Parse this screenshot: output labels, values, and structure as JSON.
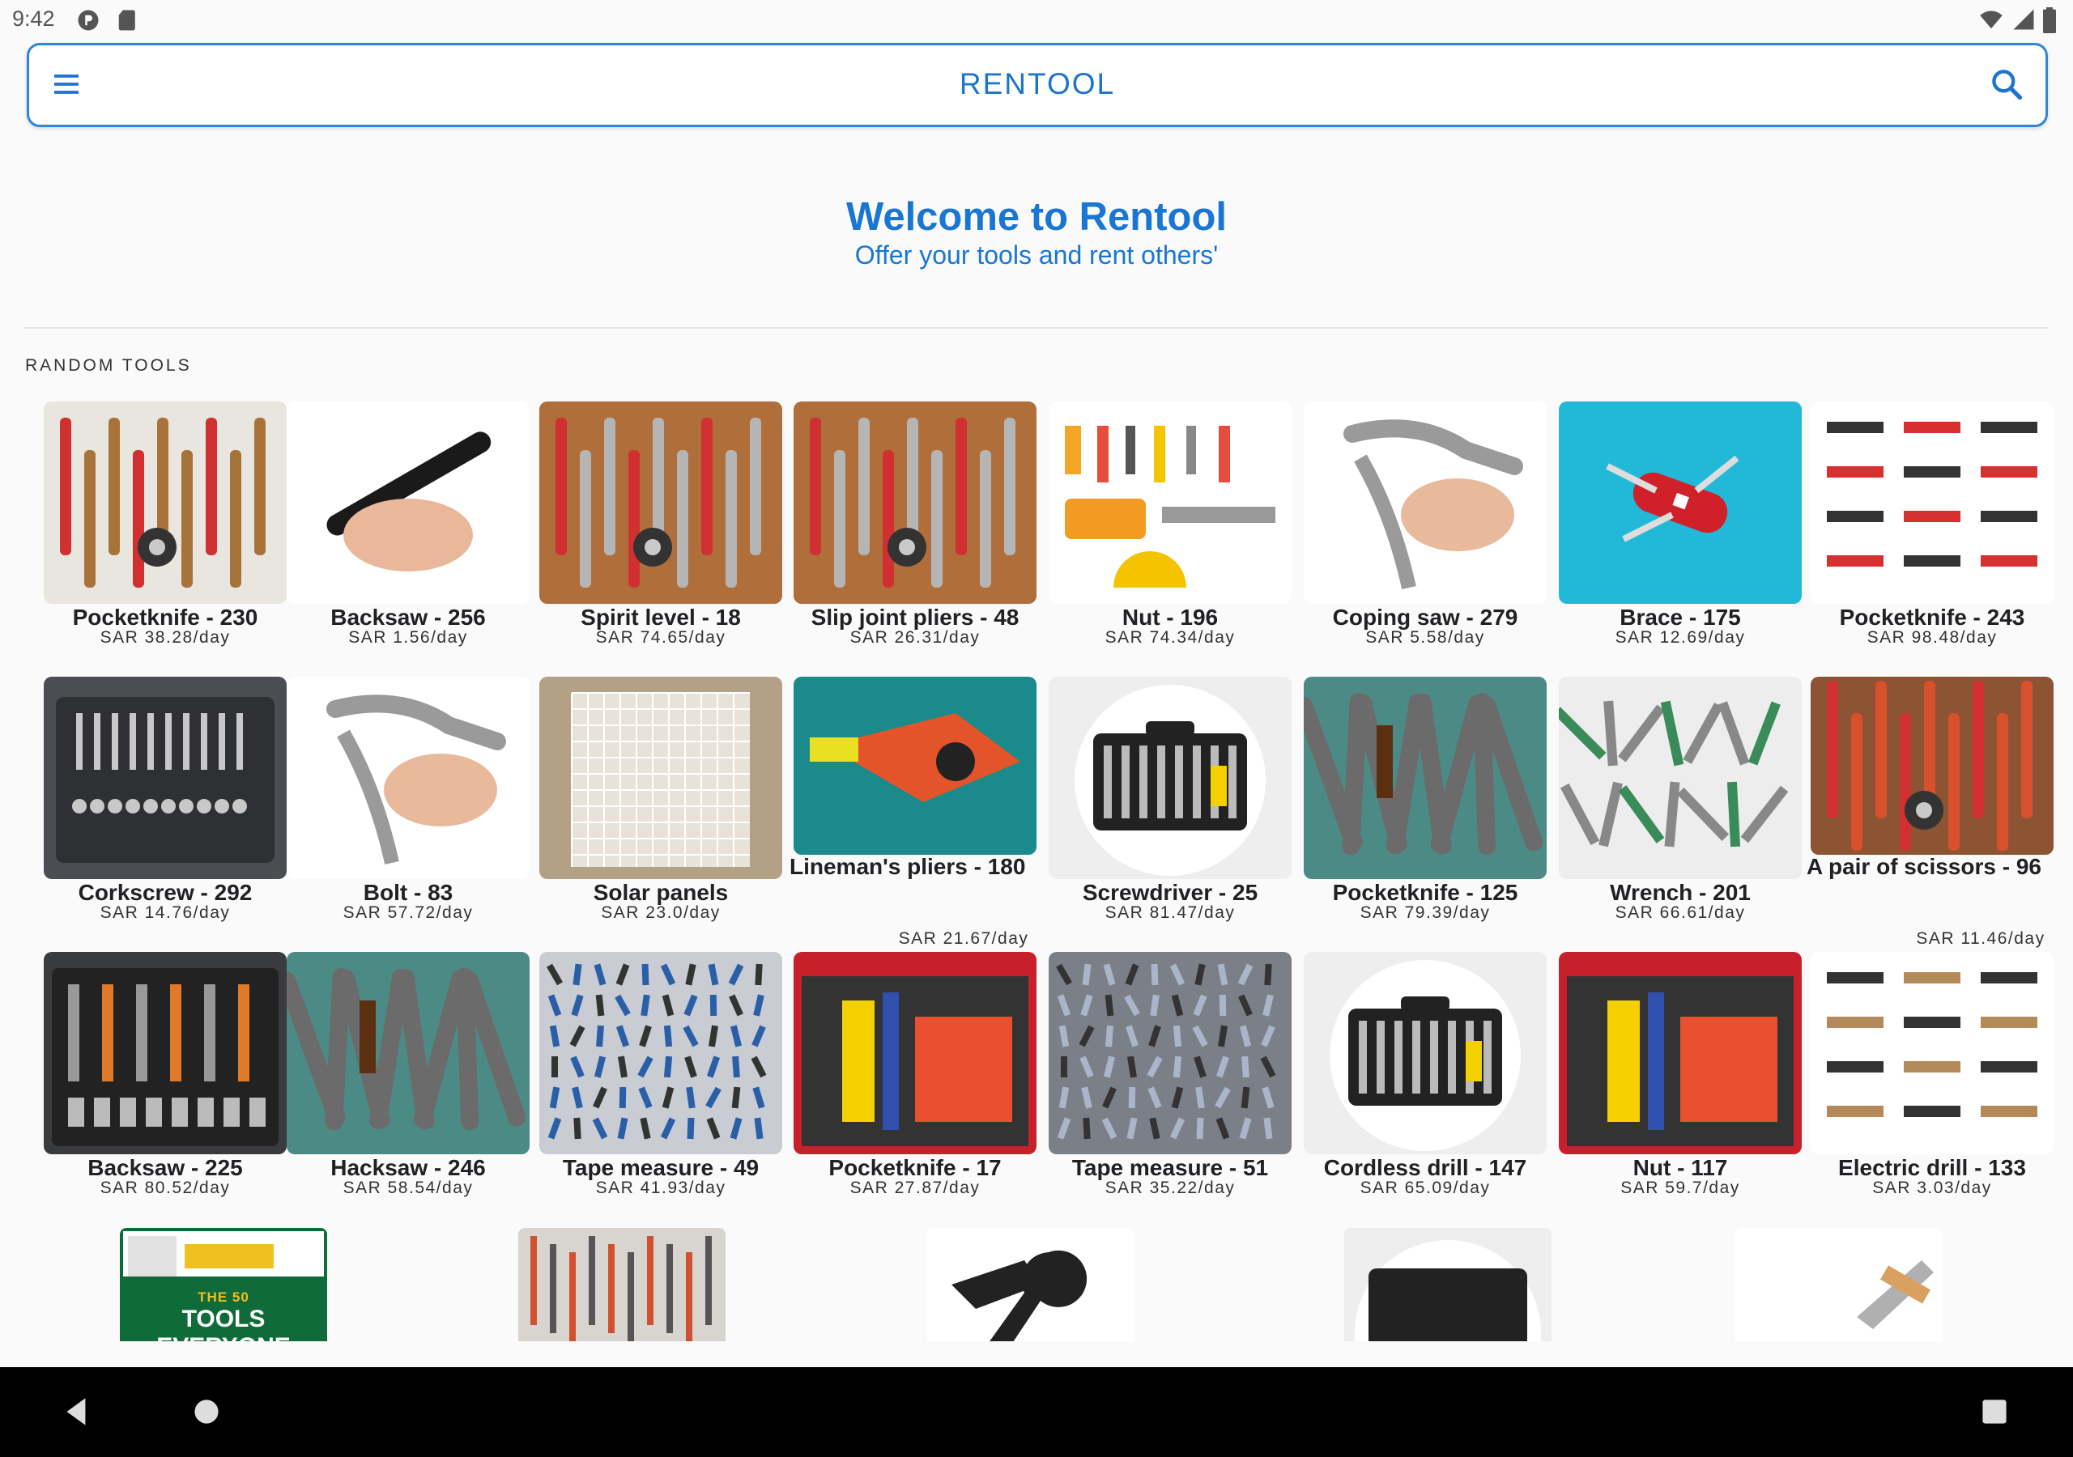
{
  "status_bar": {
    "time": "9:42"
  },
  "app_bar": {
    "title": "RENTOOL"
  },
  "header": {
    "welcome": "Welcome to Rentool",
    "subtitle": "Offer your tools and rent others'"
  },
  "section": {
    "label": "RANDOM TOOLS"
  },
  "tools": [
    {
      "name": "Pocketknife - 230",
      "price": "SAR 38.28/day",
      "icon": "craft-tools-image",
      "bg": "#e9e6e0",
      "accent": "#a8733a"
    },
    {
      "name": "Backsaw - 256",
      "price": "SAR 1.56/day",
      "icon": "engraving-pen-image",
      "bg": "#ffffff",
      "accent": "#1a1a1a"
    },
    {
      "name": "Spirit level - 18",
      "price": "SAR 74.65/day",
      "icon": "tools-on-wood-image",
      "bg": "#b06e3b",
      "accent": "#b5b5b5"
    },
    {
      "name": "Slip joint pliers - 48",
      "price": "SAR 26.31/day",
      "icon": "tools-on-wood-image",
      "bg": "#b06e3b",
      "accent": "#b5b5b5"
    },
    {
      "name": "Nut - 196",
      "price": "SAR 74.34/day",
      "icon": "tool-clipart-image",
      "bg": "#ffffff",
      "accent": "#f2a623"
    },
    {
      "name": "Coping saw - 279",
      "price": "SAR 5.58/day",
      "icon": "locking-pliers-image",
      "bg": "#ffffff",
      "accent": "#9a9a9a"
    },
    {
      "name": "Brace - 175",
      "price": "SAR 12.69/day",
      "icon": "swiss-knife-image",
      "bg": "#22b9d8",
      "accent": "#d0202a"
    },
    {
      "name": "Pocketknife - 243",
      "price": "SAR 98.48/day",
      "icon": "tool-grid-image",
      "bg": "#ffffff",
      "accent": "#d63030"
    },
    {
      "name": "Corkscrew - 292",
      "price": "SAR 14.76/day",
      "icon": "socket-set-image",
      "bg": "#4a4d52",
      "accent": "#c8c8c8"
    },
    {
      "name": "Bolt - 83",
      "price": "SAR 57.72/day",
      "icon": "locking-pliers-image",
      "bg": "#ffffff",
      "accent": "#9a9a9a"
    },
    {
      "name": "Solar panels",
      "price": "SAR 23.0/day",
      "icon": "grid-panel-image",
      "bg": "#b4a185",
      "accent": "#e8e2d8"
    },
    {
      "name": "Lineman's pliers - 180",
      "price": "SAR 21.67/day",
      "icon": "crimper-image",
      "bg": "#1a8a8a",
      "accent": "#e3542a"
    },
    {
      "name": "Screwdriver - 25",
      "price": "SAR 81.47/day",
      "icon": "tool-case-image",
      "bg": "#eeeeee",
      "accent": "#222222"
    },
    {
      "name": "Pocketknife - 125",
      "price": "SAR 79.39/day",
      "icon": "wrenches-pile-image",
      "bg": "#4c8a86",
      "accent": "#6b6b6b"
    },
    {
      "name": "Wrench - 201",
      "price": "SAR 66.61/day",
      "icon": "tools-white-image",
      "bg": "#ededed",
      "accent": "#3a8b5a"
    },
    {
      "name": "A pair of scissors - 96",
      "price": "SAR 11.46/day",
      "icon": "tools-on-wood-image",
      "bg": "#8c5433",
      "accent": "#d8502c"
    },
    {
      "name": "Backsaw - 225",
      "price": "SAR 80.52/day",
      "icon": "tool-case-open-image",
      "bg": "#3a3b3e",
      "accent": "#e07a2a"
    },
    {
      "name": "Hacksaw - 246",
      "price": "SAR 58.54/day",
      "icon": "wrenches-pile-image",
      "bg": "#4c8a86",
      "accent": "#6b6b6b"
    },
    {
      "name": "Tape measure - 49",
      "price": "SAR 41.93/day",
      "icon": "tool-wall-image",
      "bg": "#c9ccd2",
      "accent": "#2a5fa8"
    },
    {
      "name": "Pocketknife - 17",
      "price": "SAR 27.87/day",
      "icon": "red-toolbox-image",
      "bg": "#c7202a",
      "accent": "#f5d000"
    },
    {
      "name": "Tape measure - 51",
      "price": "SAR 35.22/day",
      "icon": "tools-floor-image",
      "bg": "#7b7f88",
      "accent": "#a9b5c8"
    },
    {
      "name": "Cordless drill - 147",
      "price": "SAR 65.09/day",
      "icon": "tool-case-image",
      "bg": "#eeeeee",
      "accent": "#222222"
    },
    {
      "name": "Nut - 117",
      "price": "SAR 59.7/day",
      "icon": "red-toolbox-image",
      "bg": "#c7202a",
      "accent": "#f5d000"
    },
    {
      "name": "Electric drill - 133",
      "price": "SAR 3.03/day",
      "icon": "tool-layout-image",
      "bg": "#ffffff",
      "accent": "#b58a5a"
    }
  ],
  "peek_tools": [
    {
      "icon": "book-cover-image",
      "bg": "#0f6b3a",
      "text": "THE 50",
      "text2": "TOOLS EVERYONE"
    },
    {
      "icon": "pegboard-tools-image",
      "bg": "#d8d4d0"
    },
    {
      "icon": "hammer-wrench-icon-image",
      "bg": "#ffffff"
    },
    {
      "icon": "tool-case-image",
      "bg": "#eeeeee"
    },
    {
      "icon": "hammer-image",
      "bg": "#ffffff"
    }
  ]
}
